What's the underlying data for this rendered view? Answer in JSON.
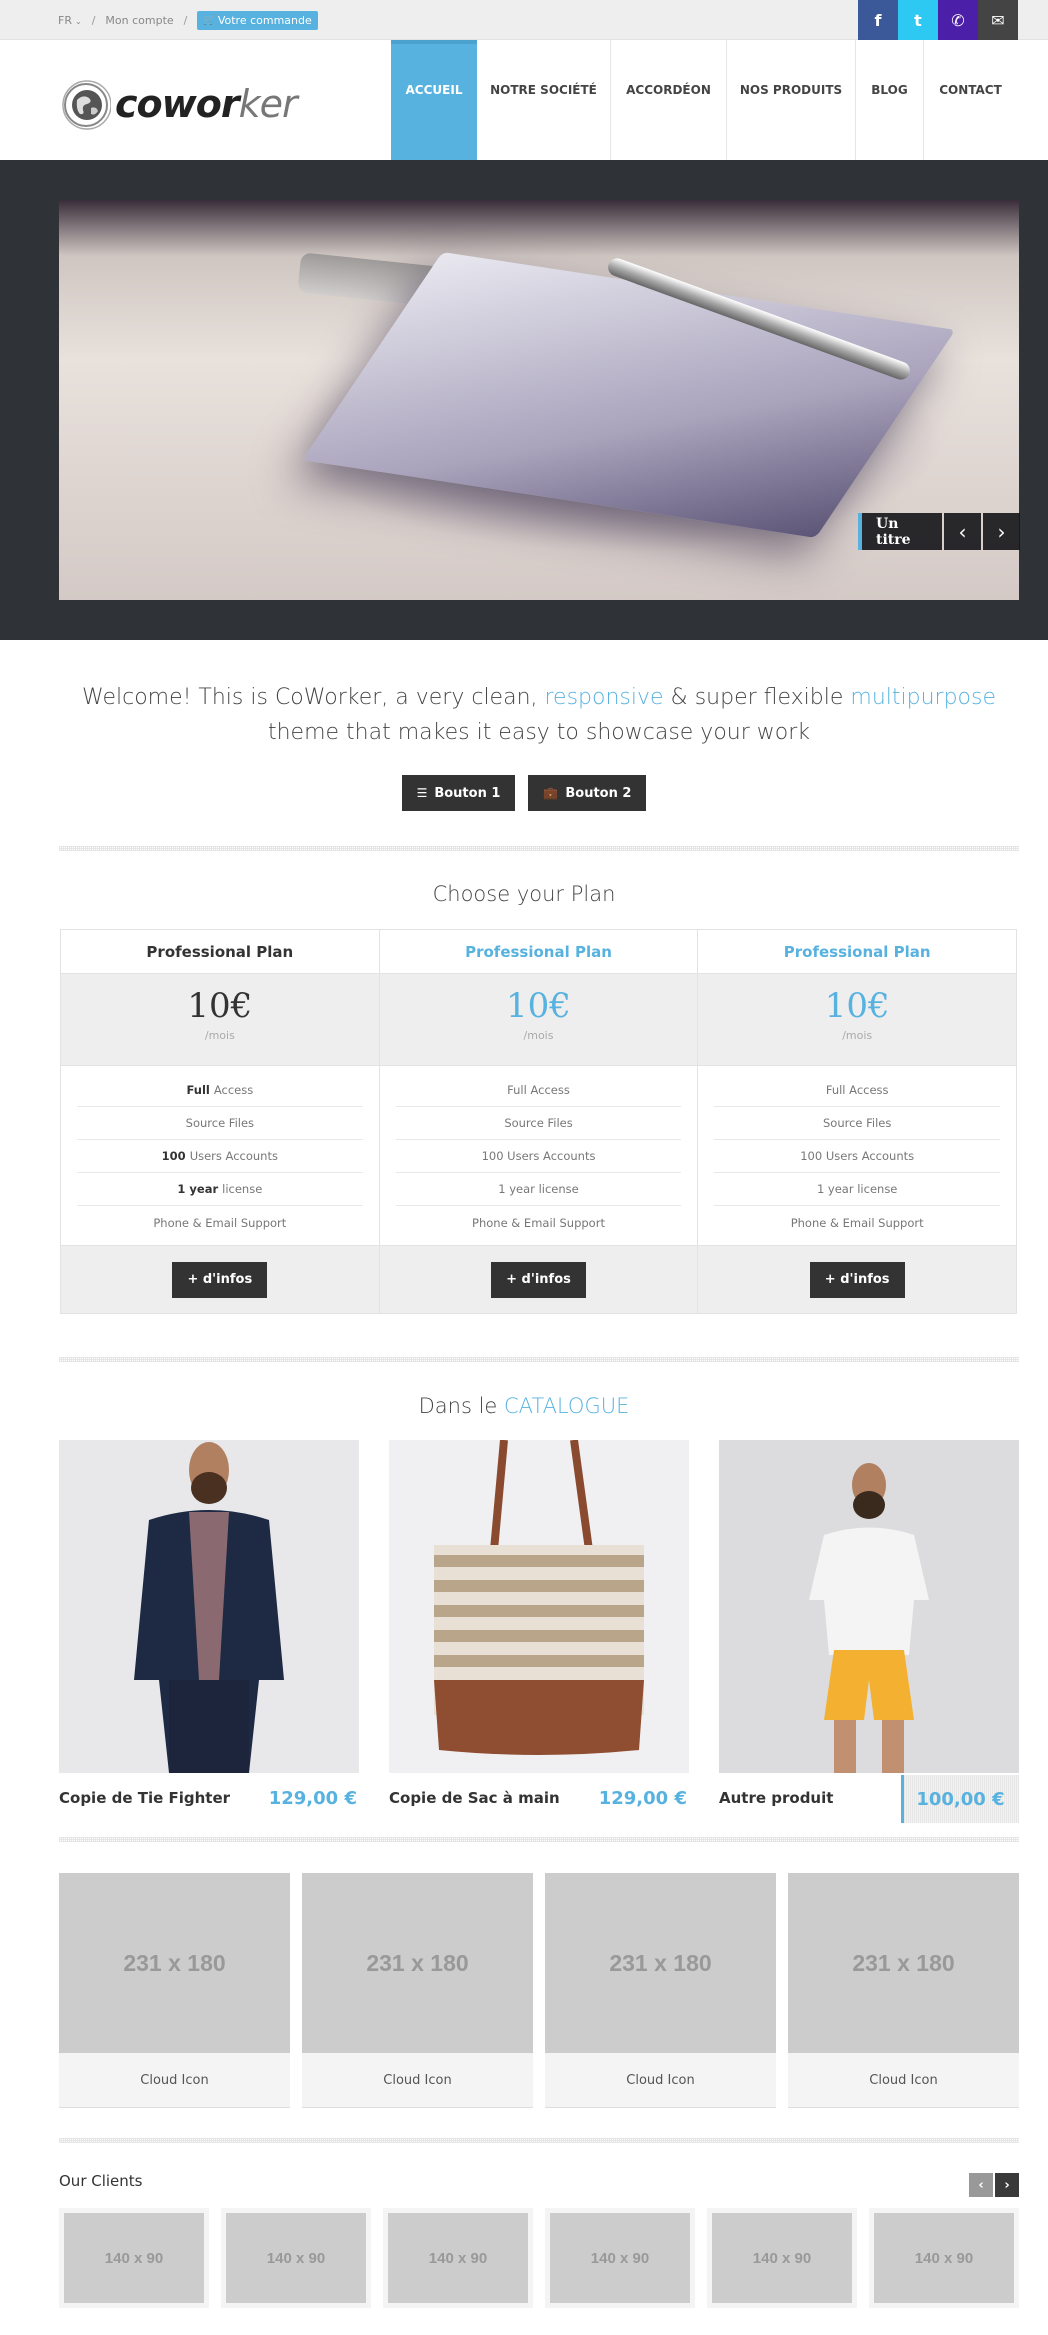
{
  "topbar": {
    "language": "FR",
    "account_link": "Mon compte",
    "separator": "/",
    "cart_button": "Votre commande",
    "social": [
      {
        "name": "facebook",
        "glyph": "f",
        "color": "#3b5998"
      },
      {
        "name": "twitter",
        "glyph": "t",
        "color": "#2ec9f3"
      },
      {
        "name": "phone",
        "glyph": "✆",
        "color": "#4b1fa7"
      },
      {
        "name": "email",
        "glyph": "✉",
        "color": "#444444"
      }
    ]
  },
  "header": {
    "logo_bold": "cowor",
    "logo_light": "ker",
    "nav": [
      {
        "label": "ACCUEIL",
        "active": true
      },
      {
        "label": "NOTRE SOCIÉTÉ",
        "active": false
      },
      {
        "label": "ACCORDÉON",
        "active": false
      },
      {
        "label": "NOS PRODUITS",
        "active": false
      },
      {
        "label": "BLOG",
        "active": false
      },
      {
        "label": "CONTACT",
        "active": false
      }
    ]
  },
  "slider": {
    "caption": "Un titre",
    "prev": "‹",
    "next": "›"
  },
  "welcome": {
    "part1": "Welcome! This is CoWorker, a very clean, ",
    "hl1": "responsive",
    "part2": " & super flexible ",
    "hl2": "multipurpose",
    "part3": " theme that makes it easy to showcase your work",
    "button1": "Bouton 1",
    "button2": "Bouton 2"
  },
  "pricing": {
    "title": "Choose your Plan",
    "plans": [
      {
        "name": "Professional Plan",
        "price": "10€",
        "period": "/mois",
        "features": [
          {
            "bold": "Full",
            "text": "Access"
          },
          {
            "bold": "",
            "text": "Source Files"
          },
          {
            "bold": "100",
            "text": "Users Accounts"
          },
          {
            "bold": "1 year",
            "text": "license"
          },
          {
            "bold": "",
            "text": "Phone & Email Support"
          }
        ],
        "button": "+ d'infos"
      },
      {
        "name": "Professional Plan",
        "price": "10€",
        "period": "/mois",
        "features": [
          {
            "bold": "",
            "text": "Full Access"
          },
          {
            "bold": "",
            "text": "Source Files"
          },
          {
            "bold": "",
            "text": "100 Users Accounts"
          },
          {
            "bold": "",
            "text": "1 year license"
          },
          {
            "bold": "",
            "text": "Phone & Email Support"
          }
        ],
        "button": "+ d'infos"
      },
      {
        "name": "Professional Plan",
        "price": "10€",
        "period": "/mois",
        "features": [
          {
            "bold": "",
            "text": "Full Access"
          },
          {
            "bold": "",
            "text": "Source Files"
          },
          {
            "bold": "",
            "text": "100 Users Accounts"
          },
          {
            "bold": "",
            "text": "1 year license"
          },
          {
            "bold": "",
            "text": "Phone & Email Support"
          }
        ],
        "button": "+ d'infos"
      }
    ]
  },
  "catalogue": {
    "title_prefix": "Dans le ",
    "title_highlight": "CATALOGUE",
    "products": [
      {
        "name": "Copie de Tie Fighter",
        "price": "129,00 €"
      },
      {
        "name": "Copie de Sac à main",
        "price": "129,00 €"
      },
      {
        "name": "Autre produit",
        "price": "100,00 €"
      }
    ]
  },
  "features": [
    {
      "placeholder": "231 x 180",
      "caption": "Cloud Icon"
    },
    {
      "placeholder": "231 x 180",
      "caption": "Cloud Icon"
    },
    {
      "placeholder": "231 x 180",
      "caption": "Cloud Icon"
    },
    {
      "placeholder": "231 x 180",
      "caption": "Cloud Icon"
    }
  ],
  "clients": {
    "title": "Our Clients",
    "prev": "‹",
    "next": "›",
    "logos": [
      "140 x 90",
      "140 x 90",
      "140 x 90",
      "140 x 90",
      "140 x 90",
      "140 x 90"
    ]
  },
  "colors": {
    "accent": "#57b2e0",
    "dark_button": "#333333",
    "slider_bg": "#2f3338"
  }
}
